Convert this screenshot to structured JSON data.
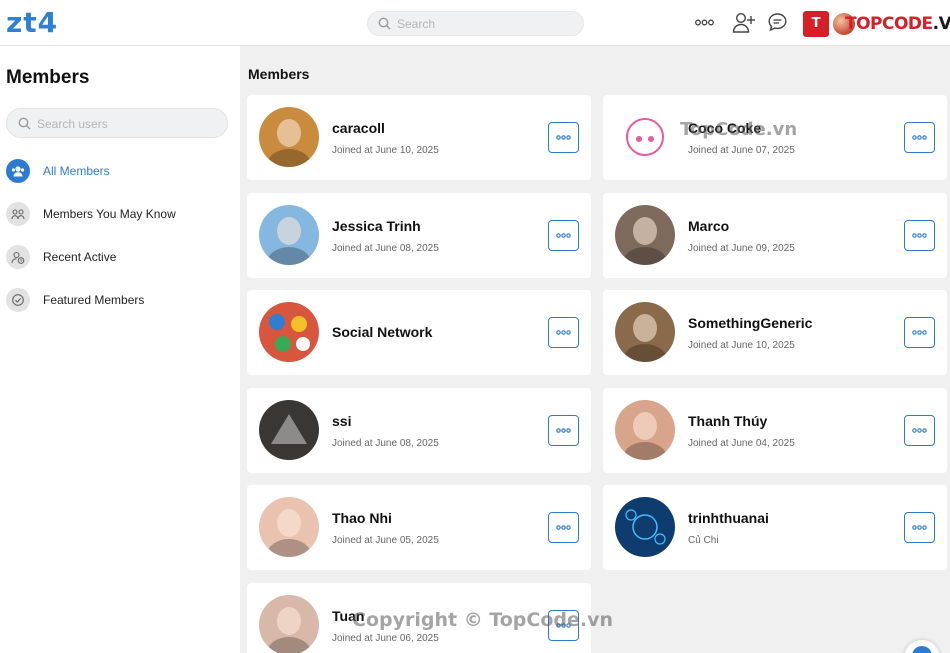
{
  "app": {
    "logo": "zt4"
  },
  "header": {
    "search_placeholder": "Search",
    "icons": [
      "more-dots-icon",
      "add-friend-icon",
      "messages-icon"
    ],
    "brand": {
      "box_text": "T",
      "name_red": "TOPCODE",
      "name_dark": ".VN",
      "caret": "▾"
    }
  },
  "sidebar": {
    "title": "Members",
    "search_placeholder": "Search users",
    "items": [
      {
        "label": "All Members",
        "icon": "members-icon",
        "active": true
      },
      {
        "label": "Members You May Know",
        "icon": "people-icon",
        "active": false
      },
      {
        "label": "Recent Active",
        "icon": "recent-user-icon",
        "active": false
      },
      {
        "label": "Featured Members",
        "icon": "check-circle-icon",
        "active": false
      }
    ]
  },
  "main": {
    "title": "Members",
    "members": [
      {
        "name": "caracoll",
        "sub": "Joined at June 10, 2025",
        "avatar": "cat-photo",
        "color": "#c98b3e"
      },
      {
        "name": "Coco Coke",
        "sub": "Joined at June 07, 2025",
        "avatar": "anime-girl-drawing",
        "color": "#f3a0c6"
      },
      {
        "name": "Jessica Trinh",
        "sub": "Joined at June 08, 2025",
        "avatar": "girl-outdoor-photo",
        "color": "#86b7e0"
      },
      {
        "name": "Marco",
        "sub": "Joined at June 09, 2025",
        "avatar": "man-glasses-photo",
        "color": "#7d6a5c"
      },
      {
        "name": "Social Network",
        "sub": "",
        "avatar": "lotto-balls",
        "color": "#d8553e"
      },
      {
        "name": "SomethingGeneric",
        "sub": "Joined at June 10, 2025",
        "avatar": "rat-photo",
        "color": "#8a6a4a"
      },
      {
        "name": "ssi",
        "sub": "Joined at June 08, 2025",
        "avatar": "dark-triangle",
        "color": "#3a3634"
      },
      {
        "name": "Thanh Thúy",
        "sub": "Joined at June 04, 2025",
        "avatar": "woman-portrait",
        "color": "#d9a48c"
      },
      {
        "name": "Thao Nhi",
        "sub": "Joined at June 05, 2025",
        "avatar": "woman-portrait",
        "color": "#e9c2b0"
      },
      {
        "name": "trinhthuanai",
        "sub": "Củ Chi",
        "avatar": "tech-icons",
        "color": "#0e3c6e"
      },
      {
        "name": "Tuan",
        "sub": "Joined at June 06, 2025",
        "avatar": "girl-portrait",
        "color": "#d8b8a8"
      }
    ]
  },
  "watermarks": {
    "top": "TopCode.vn",
    "bottom": "Copyright © TopCode.vn"
  },
  "colors": {
    "accent": "#2d7bd0",
    "brand_red": "#d61f26",
    "page_bg": "#f0f0f0"
  }
}
